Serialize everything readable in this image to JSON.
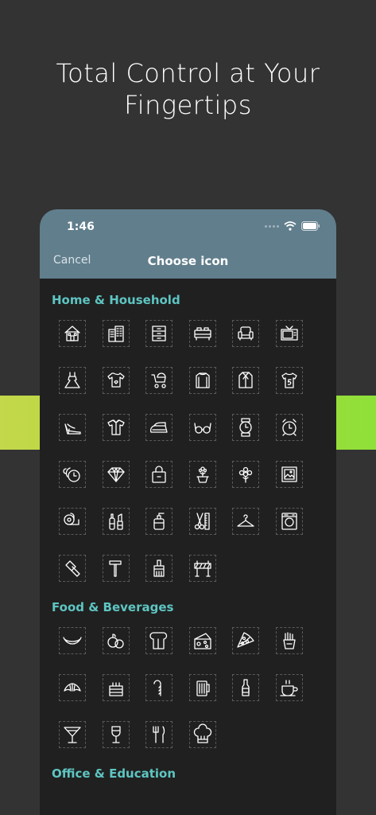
{
  "headline": [
    "Total Control at Your",
    "Fingertips"
  ],
  "status_bar": {
    "time": "1:46"
  },
  "navbar": {
    "cancel_label": "Cancel",
    "title": "Choose icon"
  },
  "sections": [
    {
      "title": "Home & Household",
      "icons": [
        "house",
        "buildings",
        "drawers",
        "bed",
        "armchair",
        "tv",
        "dress",
        "onesie",
        "stroller",
        "sweater",
        "suit",
        "jersey-5",
        "high-heel",
        "shirt",
        "iron",
        "glasses",
        "watch",
        "alarm-clock",
        "wall-clock",
        "diamond",
        "bag",
        "potted-flower",
        "flowers",
        "picture-frame",
        "toilet-paper",
        "makeup",
        "soap-dispenser",
        "scissors-comb",
        "hanger",
        "washing-machine",
        "hammer",
        "tool",
        "paint-brush",
        "barrier"
      ]
    },
    {
      "title": "Food & Beverages",
      "icons": [
        "banana",
        "fruits",
        "bread",
        "cheese",
        "pizza",
        "fries",
        "croissant",
        "cake",
        "candy-cane",
        "beer",
        "bottle",
        "coffee",
        "cocktail",
        "wine",
        "cutlery",
        "chef-hat"
      ]
    },
    {
      "title": "Office & Education",
      "icons": []
    }
  ]
}
